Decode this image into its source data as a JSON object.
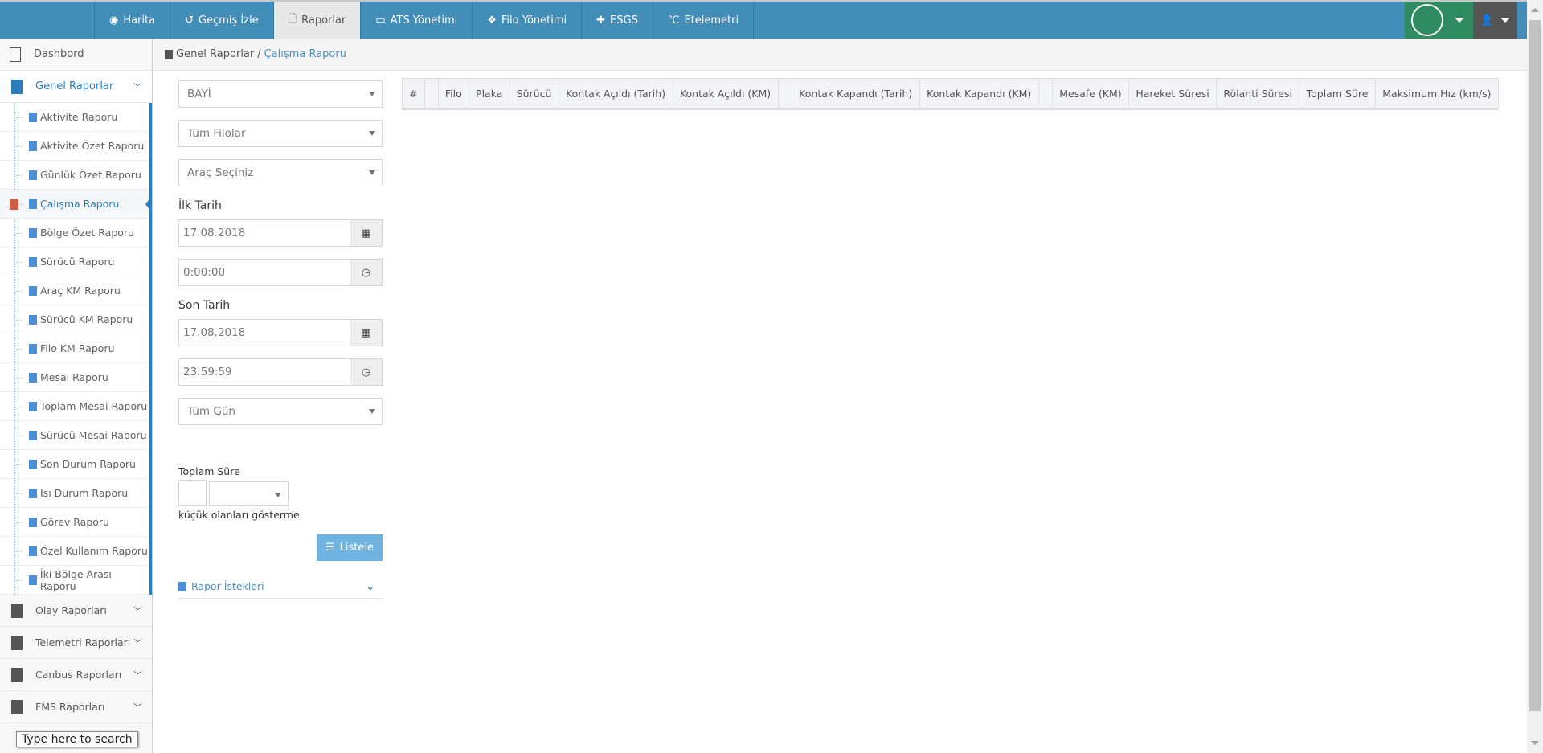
{
  "nav": {
    "items": [
      {
        "label": "Harita",
        "icon": "globe-icon",
        "glyph": "◉"
      },
      {
        "label": "Geçmiş İzle",
        "icon": "history-icon",
        "glyph": "↺"
      },
      {
        "label": "Raporlar",
        "icon": "file-icon",
        "glyph": "🗋",
        "active": true
      },
      {
        "label": "ATS Yönetimi",
        "icon": "desktop-icon",
        "glyph": "▭"
      },
      {
        "label": "Filo Yönetimi",
        "icon": "cubes-icon",
        "glyph": "❖"
      },
      {
        "label": "ESGS",
        "icon": "puzzle-icon",
        "glyph": "✚"
      },
      {
        "label": "Etelemetri",
        "icon": "celsius-icon",
        "glyph": "℃"
      }
    ]
  },
  "sidebar": {
    "dashboard": "Dashbord",
    "group_open": "Genel Raporlar",
    "sub_items": [
      "Aktivite Raporu",
      "Aktivite Özet Raporu",
      "Günlük Özet Raporu",
      "Çalışma Raporu",
      "Bölge Özet Raporu",
      "Sürücü Raporu",
      "Araç KM Raporu",
      "Sürücü KM Raporu",
      "Filo KM Raporu",
      "Mesai Raporu",
      "Toplam Mesai Raporu",
      "Sürücü Mesai Raporu",
      "Son Durum Raporu",
      "Isı Durum Raporu",
      "Görev Raporu",
      "Özel Kullanım Raporu",
      "İki Bölge Arası Raporu"
    ],
    "active_sub": "Çalışma Raporu",
    "groups": [
      "Olay Raporları",
      "Telemetri Raporları",
      "Canbus Raporları",
      "FMS Raporları"
    ]
  },
  "breadcrumb": {
    "parent": "Genel Raporlar",
    "sep": "/",
    "current": "Çalışma Raporu"
  },
  "form": {
    "dealer": "BAYİ",
    "fleet": "Tüm Filolar",
    "vehicle": "Araç Seçiniz",
    "start_label": "İlk Tarih",
    "start_date": "17.08.2018",
    "start_time": "0:00:00",
    "end_label": "Son Tarih",
    "end_date": "17.08.2018",
    "end_time": "23:59:59",
    "day": "Tüm Gün",
    "total_label": "Toplam Süre",
    "total_value": "",
    "total_unit": "",
    "hide_label": "küçük olanları gösterme",
    "list_button": "Listele",
    "requests": "Rapor İstekleri"
  },
  "table": {
    "columns": [
      "#",
      "",
      "Filo",
      "Plaka",
      "Sürücü",
      "Kontak Açıldı (Tarih)",
      "Kontak Açıldı (KM)",
      "",
      "Kontak Kapandı (Tarih)",
      "Kontak Kapandı (KM)",
      "",
      "Mesafe (KM)",
      "Hareket Süresi",
      "Rölanti Süresi",
      "Toplam Süre",
      "Maksimum Hız (km/s)"
    ],
    "rows": []
  },
  "taskbar": {
    "search_tooltip": "Type here to search"
  },
  "colors": {
    "nav": "#438eb9",
    "accent": "#2b7dbc",
    "green": "#2e8b62",
    "button": "#6fb3e0",
    "active_marker": "#d15b47"
  }
}
